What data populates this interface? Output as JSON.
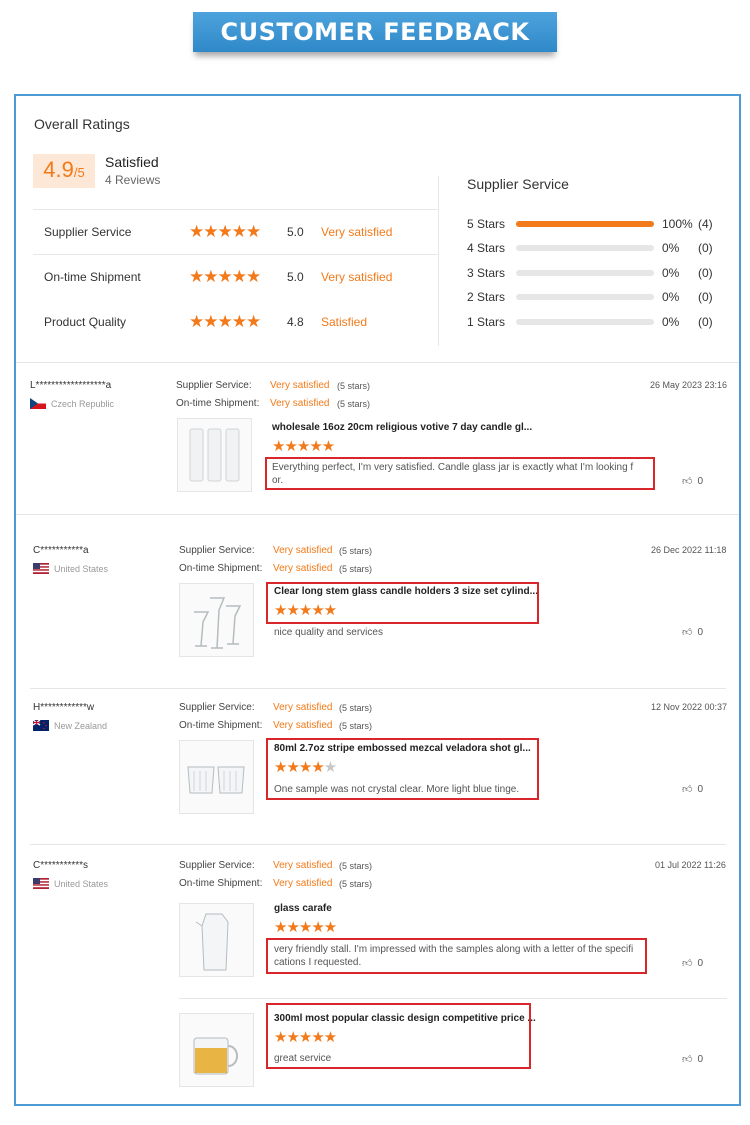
{
  "banner": "CUSTOMER FEEDBACK",
  "overall": {
    "title": "Overall Ratings",
    "score": "4.9",
    "score_max": "/5",
    "satisfied": "Satisfied",
    "reviews": "4 Reviews",
    "ratings": [
      {
        "label": "Supplier Service",
        "stars": 5,
        "score": "5.0",
        "text": "Very satisfied"
      },
      {
        "label": "On-time Shipment",
        "stars": 5,
        "score": "5.0",
        "text": "Very satisfied"
      },
      {
        "label": "Product Quality",
        "stars": 4.8,
        "score": "4.8",
        "text": "Satisfied"
      }
    ]
  },
  "supplier_service": {
    "title": "Supplier Service",
    "distribution": [
      {
        "label": "5  Stars",
        "percent": 100,
        "pct": "100%",
        "count": "(4)"
      },
      {
        "label": "4  Stars",
        "percent": 0,
        "pct": "0%",
        "count": "(0)"
      },
      {
        "label": "3  Stars",
        "percent": 0,
        "pct": "0%",
        "count": "(0)"
      },
      {
        "label": "2  Stars",
        "percent": 0,
        "pct": "0%",
        "count": "(0)"
      },
      {
        "label": "1  Stars",
        "percent": 0,
        "pct": "0%",
        "count": "(0)"
      }
    ]
  },
  "labels": {
    "supplier_service": "Supplier Service:",
    "ontime_shipment": "On-time Shipment:",
    "very_satisfied": "Very satisfied",
    "five_stars": "(5 stars)"
  },
  "reviews": [
    {
      "reviewer": "L******************a",
      "country": "Czech Republic",
      "date": "26 May 2023 23:16",
      "products": [
        {
          "title": "wholesale 16oz 20cm religious votive 7 day candle gl...",
          "stars": 5,
          "text": "Everything perfect, I'm very satisfied. Candle glass jar is exactly what I'm looking f or.",
          "likes": "0"
        }
      ]
    },
    {
      "reviewer": "C***********a",
      "country": "United States",
      "date": "26 Dec 2022 11:18",
      "products": [
        {
          "title": "Clear long stem glass candle holders 3 size set cylind...",
          "stars": 5,
          "text": "nice quality and services",
          "likes": "0"
        }
      ]
    },
    {
      "reviewer": "H************w",
      "country": "New Zealand",
      "date": "12 Nov 2022 00:37",
      "products": [
        {
          "title": "80ml 2.7oz stripe embossed mezcal veladora shot gl...",
          "stars": 4,
          "text": "One sample was not crystal clear. More light blue tinge.",
          "likes": "0"
        }
      ]
    },
    {
      "reviewer": "C***********s",
      "country": "United States",
      "date": "01 Jul 2022 11:26",
      "products": [
        {
          "title": "glass carafe",
          "stars": 5,
          "text": "very friendly stall. I'm impressed with the samples along with a letter of the specifi cations I requested.",
          "likes": "0"
        },
        {
          "title": "300ml most popular classic design competitive price ...",
          "stars": 5,
          "text": "great service",
          "likes": "0"
        }
      ]
    }
  ],
  "colors": {
    "accent": "#f27a1a",
    "highlight": "#d9262b",
    "banner": "#3a92d0"
  }
}
